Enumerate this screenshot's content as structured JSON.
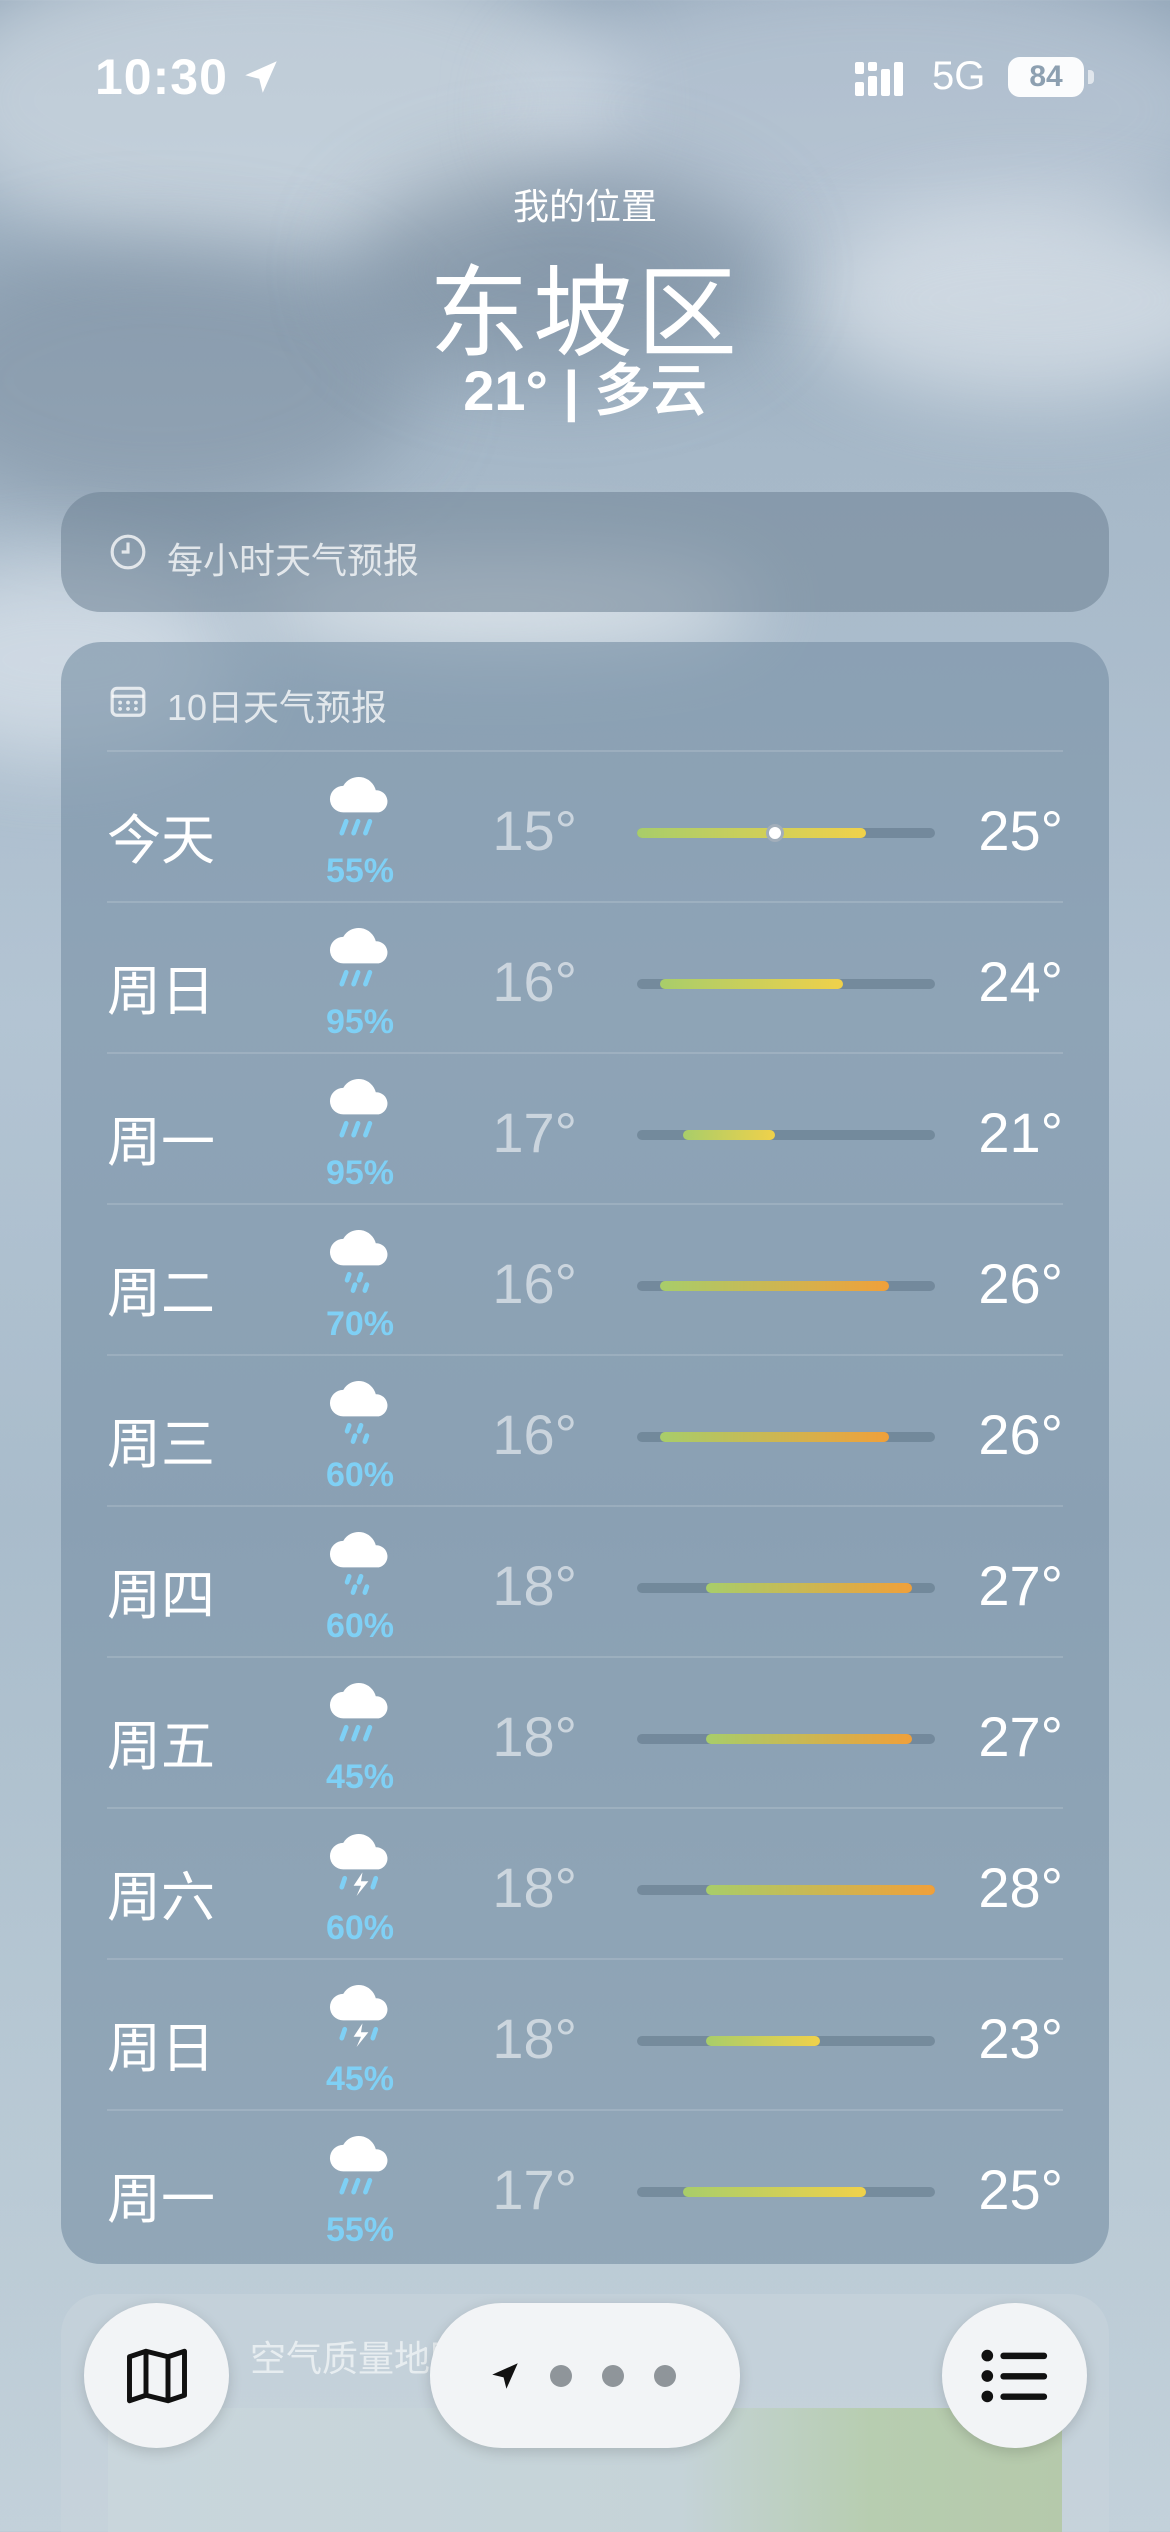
{
  "status_bar": {
    "time": "10:30",
    "network": "5G",
    "battery": "84",
    "location_icon": "location-arrow-icon",
    "signal_icon": "cellular-signal-icon"
  },
  "header": {
    "subtitle": "我的位置",
    "city": "东坡区",
    "current": "21° | 多云"
  },
  "hourly_card": {
    "title": "每小时天气预报",
    "icon": "clock-icon"
  },
  "forecast_card": {
    "title": "10日天气预报",
    "icon": "calendar-icon",
    "scale_min": 15,
    "scale_max": 28,
    "current_temp": 21,
    "days": [
      {
        "day": "今天",
        "icon": "rain-cloud-icon",
        "precip": "55%",
        "low": "15°",
        "high": "25°",
        "lo_v": 15,
        "hi_v": 25,
        "now": true
      },
      {
        "day": "周日",
        "icon": "rain-cloud-icon",
        "precip": "95%",
        "low": "16°",
        "high": "24°",
        "lo_v": 16,
        "hi_v": 24
      },
      {
        "day": "周一",
        "icon": "rain-cloud-icon",
        "precip": "95%",
        "low": "17°",
        "high": "21°",
        "lo_v": 17,
        "hi_v": 21
      },
      {
        "day": "周二",
        "icon": "drizzle-cloud-icon",
        "precip": "70%",
        "low": "16°",
        "high": "26°",
        "lo_v": 16,
        "hi_v": 26
      },
      {
        "day": "周三",
        "icon": "drizzle-cloud-icon",
        "precip": "60%",
        "low": "16°",
        "high": "26°",
        "lo_v": 16,
        "hi_v": 26
      },
      {
        "day": "周四",
        "icon": "drizzle-cloud-icon",
        "precip": "60%",
        "low": "18°",
        "high": "27°",
        "lo_v": 18,
        "hi_v": 27
      },
      {
        "day": "周五",
        "icon": "rain-cloud-icon",
        "precip": "45%",
        "low": "18°",
        "high": "27°",
        "lo_v": 18,
        "hi_v": 27
      },
      {
        "day": "周六",
        "icon": "thunderstorm-cloud-icon",
        "precip": "60%",
        "low": "18°",
        "high": "28°",
        "lo_v": 18,
        "hi_v": 28
      },
      {
        "day": "周日",
        "icon": "thunderstorm-cloud-icon",
        "precip": "45%",
        "low": "18°",
        "high": "23°",
        "lo_v": 18,
        "hi_v": 23
      },
      {
        "day": "周一",
        "icon": "rain-cloud-icon",
        "precip": "55%",
        "low": "17°",
        "high": "25°",
        "lo_v": 17,
        "hi_v": 25
      }
    ]
  },
  "air_quality_card": {
    "title": "空气质量地图"
  },
  "bottom_nav": {
    "map_icon": "map-icon",
    "location_icon": "location-arrow-icon",
    "list_icon": "list-icon"
  },
  "colors": {
    "precip": "#7fd0f5",
    "cool": "#a8cd6a",
    "mild": "#f0d14a",
    "warm": "#f0a03a"
  }
}
